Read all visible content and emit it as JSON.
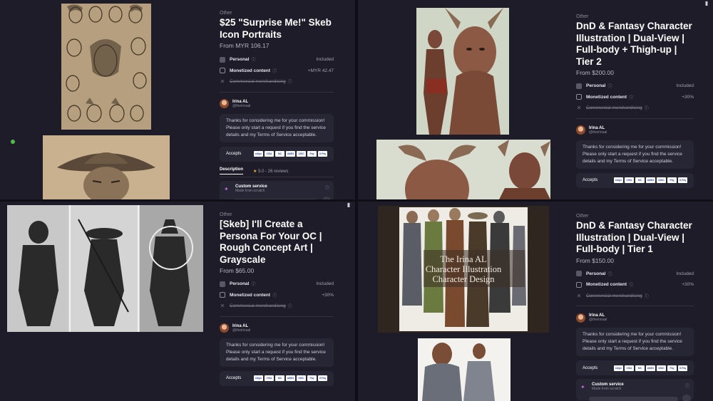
{
  "common": {
    "category": "Other",
    "included": "Included",
    "personal": "Personal",
    "monetized": "Monetized content",
    "commercial": "Commercial merchandising",
    "artist_name": "Irina AL",
    "artist_handle": "@theirinaal",
    "message": "Thanks for considering me for your commission! Please only start a request if you find the service details and my Terms of Service acceptable.",
    "accepts": "Accepts",
    "payment_methods": [
      "stripe",
      "VISA",
      "MC",
      "AMEX",
      "DISC",
      "Pay",
      "G Pay"
    ]
  },
  "panes": [
    {
      "title": "$25 \"Surprise Me!\" Skeb Icon Portraits",
      "price": "From MYR 106.17",
      "monetized_extra": "+MYR 42.47",
      "tab_label": "Description",
      "rating": "5.0 - 26 reviews",
      "service_title": "Custom service",
      "service_sub": "Made from scratch"
    },
    {
      "title": "DnD & Fantasy Character Illustration | Dual-View | Full-body + Thigh-up | Tier 2",
      "price": "From $200.00",
      "monetized_extra": "+30%"
    },
    {
      "title": "[Skeb] I'll Create a Persona For Your OC | Rough Concept Art | Grayscale",
      "price": "From $65.00",
      "monetized_extra": "+30%"
    },
    {
      "title": "DnD & Fantasy Character Illustration | Dual-View | Full-body | Tier 1",
      "price": "From $150.00",
      "monetized_extra": "+30%",
      "art_caption": [
        "The Irina AL",
        "Character Illustration",
        "Character Design"
      ],
      "service_title": "Custom service",
      "service_sub": "Made from scratch"
    }
  ],
  "icons": {
    "bookmark": "bookmark-icon",
    "info": "info-icon",
    "star": "star-icon",
    "sparkle": "sparkle-icon",
    "cross": "cross-icon",
    "online": "online-status-icon"
  },
  "colors": {
    "background": "#1d1c28",
    "card": "#272635",
    "star": "#f5b53f",
    "online": "#4fbd4a"
  }
}
